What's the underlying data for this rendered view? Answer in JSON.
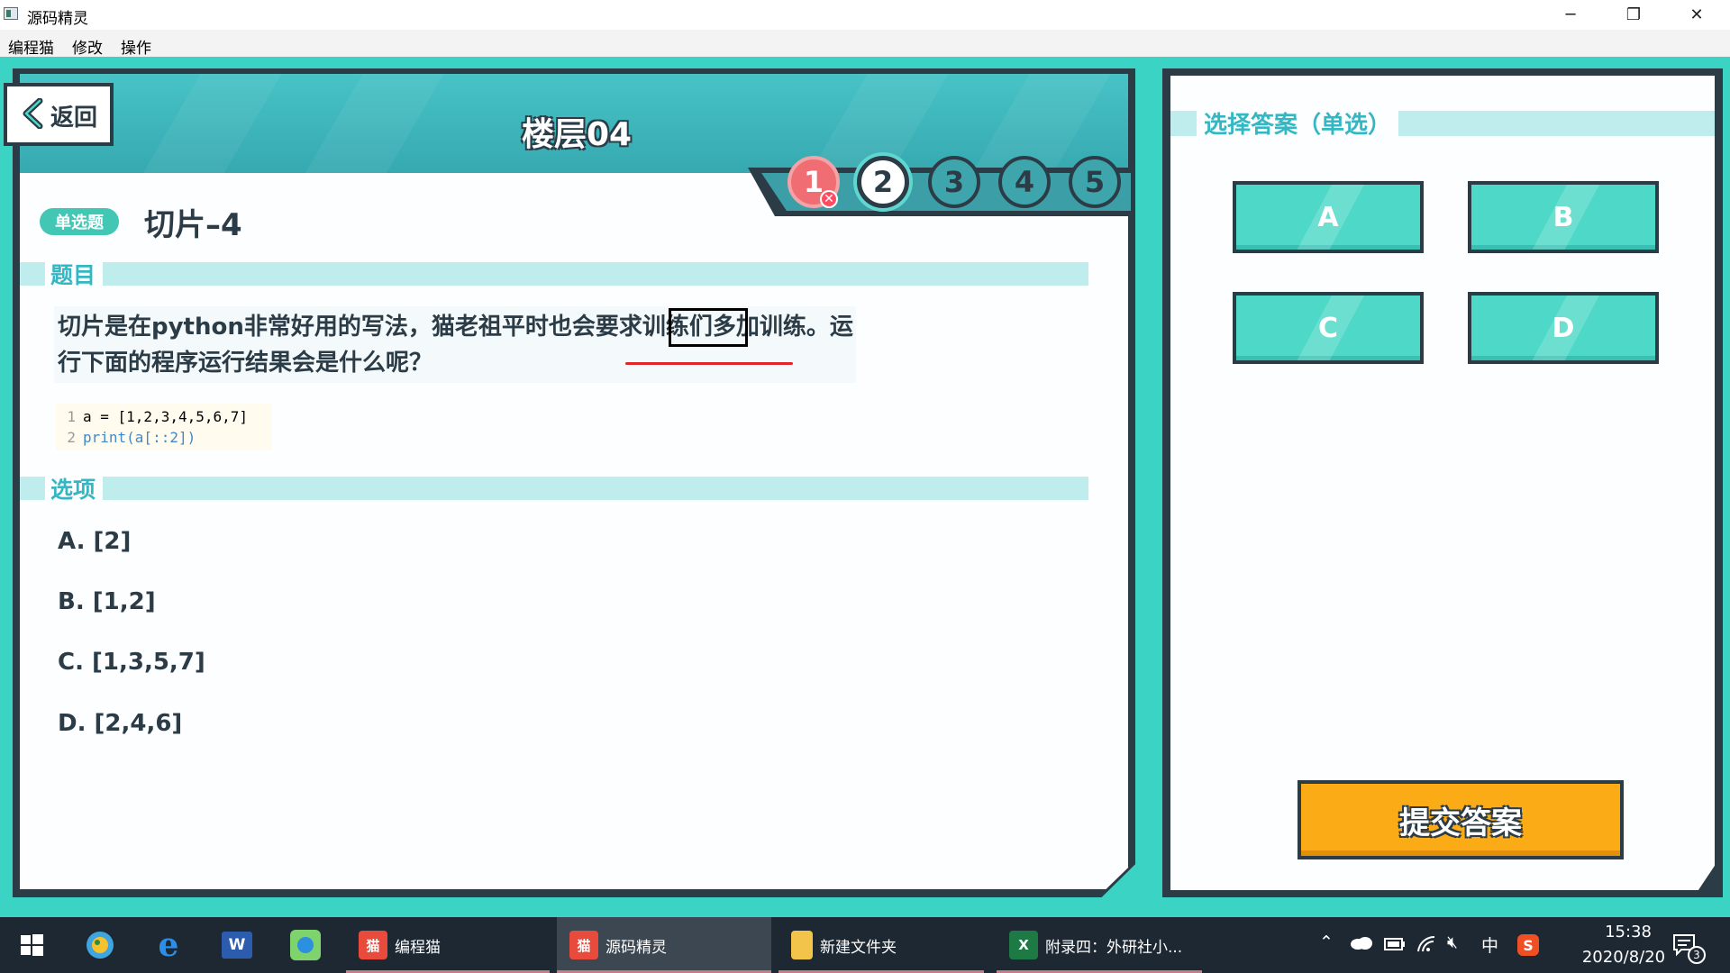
{
  "window": {
    "title": "源码精灵",
    "minimize": "─",
    "restore": "❐",
    "close": "✕"
  },
  "menu": [
    "编程猫",
    "修改",
    "操作"
  ],
  "header": {
    "back_label": "返回",
    "floor_title": "楼层04"
  },
  "steps": [
    {
      "label": "1",
      "state": "wrong"
    },
    {
      "label": "2",
      "state": "current"
    },
    {
      "label": "3",
      "state": "pending"
    },
    {
      "label": "4",
      "state": "pending"
    },
    {
      "label": "5",
      "state": "pending"
    }
  ],
  "question": {
    "type_badge": "单选题",
    "title": "切片–4",
    "section_label": "题目",
    "text": "切片是在python非常好用的写法，猫老祖平时也会要求训练们多加训练。运行下面的程序运行结果会是什么呢？",
    "code": [
      {
        "n": "1",
        "text": "a = [1,2,3,4,5,6,7]"
      },
      {
        "n": "2",
        "text": "print(a[::2])"
      }
    ]
  },
  "options": {
    "section_label": "选项",
    "items": [
      "A. [2]",
      "B. [1,2]",
      "C. [1,3,5,7]",
      "D. [2,4,6]"
    ]
  },
  "answer_panel": {
    "label": "选择答案（单选）",
    "choices": [
      "A",
      "B",
      "C",
      "D"
    ],
    "submit_label": "提交答案"
  },
  "taskbar": {
    "apps": [
      {
        "label": "编程猫",
        "active": false
      },
      {
        "label": "源码精灵",
        "active": true
      },
      {
        "label": "新建文件夹",
        "active": false
      },
      {
        "label": "附录四：外研社小...",
        "active": false
      }
    ],
    "tray_ime": "中",
    "time": "15:38",
    "date": "2020/8/20",
    "notification_count": "3"
  },
  "colors": {
    "accent": "#3bd3c4",
    "dark": "#2c3c47",
    "submit": "#fbab16",
    "wrong": "#ef6d73"
  }
}
